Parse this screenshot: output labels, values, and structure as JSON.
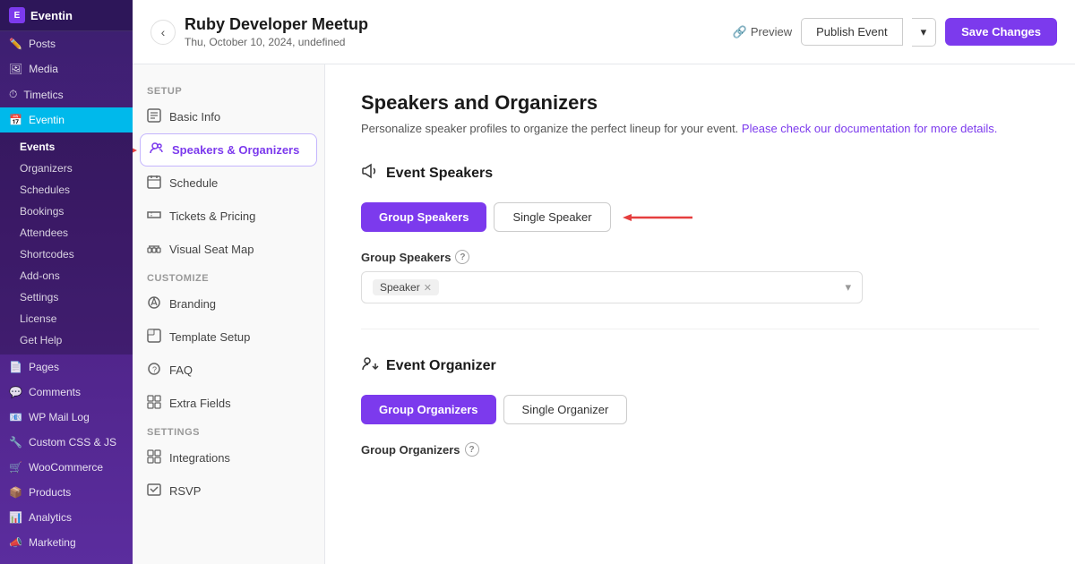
{
  "sidebar": {
    "logo": "Eventin",
    "items": [
      {
        "label": "Posts",
        "icon": "📝",
        "active": false
      },
      {
        "label": "Media",
        "icon": "🖼️",
        "active": false
      },
      {
        "label": "Timetics",
        "icon": "⏱️",
        "active": false
      },
      {
        "label": "Eventin",
        "icon": "📅",
        "active": true
      },
      {
        "label": "Pages",
        "icon": "📄",
        "active": false
      },
      {
        "label": "Comments",
        "icon": "💬",
        "active": false
      },
      {
        "label": "WP Mail Log",
        "icon": "📧",
        "active": false
      },
      {
        "label": "Custom CSS & JS",
        "icon": "🔧",
        "active": false
      },
      {
        "label": "WooCommerce",
        "icon": "🛒",
        "active": false
      },
      {
        "label": "Products",
        "icon": "📦",
        "active": false
      },
      {
        "label": "Analytics",
        "icon": "📊",
        "active": false
      },
      {
        "label": "Marketing",
        "icon": "📣",
        "active": false
      }
    ],
    "eventin_sub": [
      "Events",
      "Organizers",
      "Schedules",
      "Bookings",
      "Attendees",
      "Shortcodes",
      "Add-ons",
      "Settings",
      "License",
      "Get Help"
    ]
  },
  "topbar": {
    "back_label": "‹",
    "event_title": "Ruby Developer Meetup",
    "event_date": "Thu, October 10, 2024, undefined",
    "preview_label": "Preview",
    "publish_label": "Publish Event",
    "dropdown_label": "▾",
    "save_label": "Save Changes"
  },
  "left_nav": {
    "setup_label": "Setup",
    "setup_items": [
      {
        "label": "Basic Info",
        "active": false
      },
      {
        "label": "Speakers & Organizers",
        "active": true
      },
      {
        "label": "Schedule",
        "active": false
      },
      {
        "label": "Tickets & Pricing",
        "active": false
      },
      {
        "label": "Visual Seat Map",
        "active": false
      }
    ],
    "customize_label": "Customize",
    "customize_items": [
      {
        "label": "Branding",
        "active": false
      },
      {
        "label": "Template Setup",
        "active": false
      },
      {
        "label": "FAQ",
        "active": false
      },
      {
        "label": "Extra Fields",
        "active": false
      }
    ],
    "settings_label": "Settings",
    "settings_items": [
      {
        "label": "Integrations",
        "active": false
      },
      {
        "label": "RSVP",
        "active": false
      }
    ]
  },
  "main": {
    "page_title": "Speakers and Organizers",
    "page_desc": "Personalize speaker profiles to organize the perfect lineup for your event.",
    "page_desc_link": "Please check our documentation for more details.",
    "speakers_section": {
      "title": "Event Speakers",
      "icon": "🔔",
      "btn_group": [
        {
          "label": "Group Speakers",
          "primary": true
        },
        {
          "label": "Single Speaker",
          "primary": false
        }
      ],
      "group_label": "Group Speakers",
      "help_icon": "?",
      "select_tag": "Speaker",
      "select_placeholder": ""
    },
    "organizer_section": {
      "title": "Event Organizer",
      "icon": "↔️",
      "btn_group": [
        {
          "label": "Group Organizers",
          "primary": true
        },
        {
          "label": "Single Organizer",
          "primary": false
        }
      ],
      "group_label": "Group Organizers",
      "help_icon": "?"
    }
  }
}
